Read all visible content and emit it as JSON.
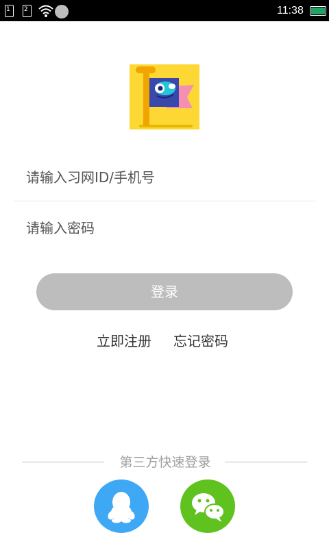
{
  "status_bar": {
    "sim1": "1",
    "sim2": "2",
    "time": "11:38",
    "battery_color": "#21a366"
  },
  "logo": {
    "icon": "flag-mascot-icon",
    "background": "#fdd835"
  },
  "form": {
    "account_placeholder": "请输入习网ID/手机号",
    "password_placeholder": "请输入密码",
    "login_label": "登录",
    "login_button_color": "#bdbdbd"
  },
  "links": {
    "register": "立即注册",
    "forgot_password": "忘记密码"
  },
  "third_party": {
    "label": "第三方快速登录",
    "qq": {
      "icon": "qq-penguin-icon",
      "color": "#3fa8f4"
    },
    "wechat": {
      "icon": "wechat-icon",
      "color": "#60c21f"
    }
  }
}
